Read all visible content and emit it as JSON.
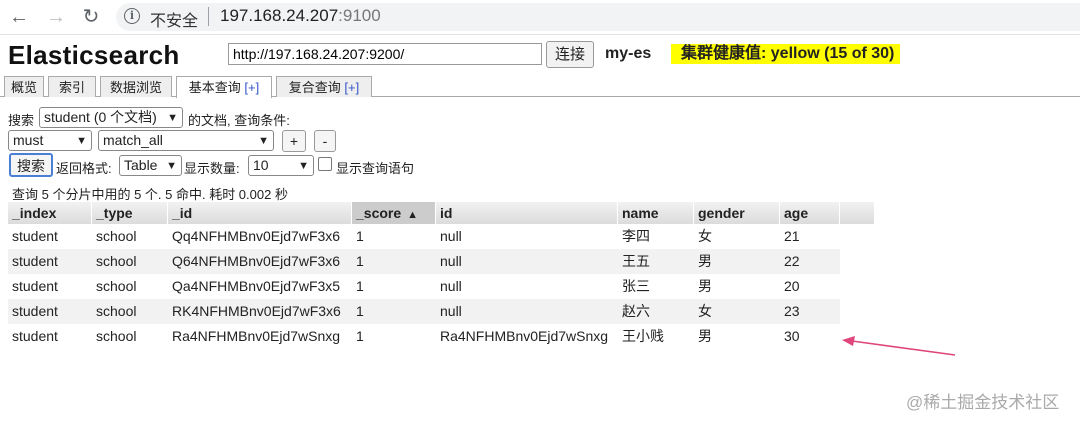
{
  "browser": {
    "insecure_label": "不安全",
    "url_host": "197.168.24.207",
    "url_port": ":9100",
    "back_icon": "←",
    "forward_icon": "→",
    "reload_icon": "↻",
    "info_icon": "i"
  },
  "header": {
    "title": "Elasticsearch",
    "cluster_url": "http://197.168.24.207:9200/",
    "connect_label": "连接",
    "cluster_name": "my-es",
    "health": "集群健康值: yellow (15 of 30)",
    "health_color": "#ffff00"
  },
  "tabs": [
    {
      "label": "概览"
    },
    {
      "label": "索引"
    },
    {
      "label": "数据浏览"
    },
    {
      "label": "基本查询",
      "plus": "[+]"
    },
    {
      "label": "复合查询",
      "plus": "[+]"
    }
  ],
  "query": {
    "search_label": "搜索",
    "index_value": "student (0 个文档)",
    "doc_label": "的文档,  查询条件:",
    "bool_value": "must",
    "clause_value": "match_all",
    "add_label": "+",
    "remove_label": "-",
    "search_button": "搜索",
    "format_label": "返回格式:",
    "format_value": "Table",
    "count_label": "显示数量:",
    "count_value": "10",
    "show_query_label": "显示查询语句"
  },
  "results": {
    "summary": "查询 5 个分片中用的 5 个. 5 命中. 耗时 0.002 秒",
    "columns": [
      "_index",
      "_type",
      "_id",
      "_score",
      "id",
      "name",
      "gender",
      "age"
    ],
    "sorted_column": "_score",
    "sort_arrow": "▲",
    "rows": [
      [
        "student",
        "school",
        "Qq4NFHMBnv0Ejd7wF3x6",
        "1",
        "null",
        "李四",
        "女",
        "21"
      ],
      [
        "student",
        "school",
        "Q64NFHMBnv0Ejd7wF3x6",
        "1",
        "null",
        "王五",
        "男",
        "22"
      ],
      [
        "student",
        "school",
        "Qa4NFHMBnv0Ejd7wF3x5",
        "1",
        "null",
        "张三",
        "男",
        "20"
      ],
      [
        "student",
        "school",
        "RK4NFHMBnv0Ejd7wF3x6",
        "1",
        "null",
        "赵六",
        "女",
        "23"
      ],
      [
        "student",
        "school",
        "Ra4NFHMBnv0Ejd7wSnxg",
        "1",
        "Ra4NFHMBnv0Ejd7wSnxg",
        "王小贱",
        "男",
        "30"
      ]
    ]
  },
  "annotation": {
    "arrow_color": "#e0457b"
  },
  "watermark": "@稀土掘金技术社区"
}
